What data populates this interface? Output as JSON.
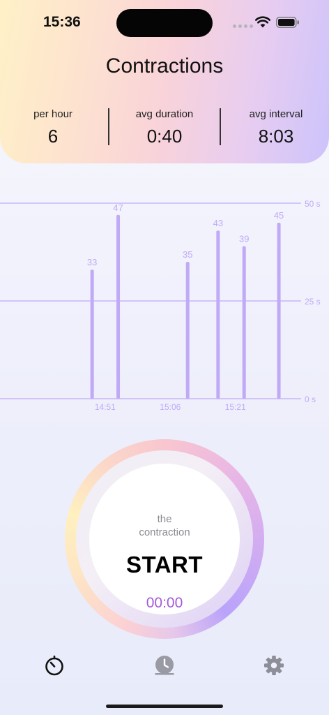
{
  "status_bar": {
    "time": "15:36"
  },
  "header": {
    "title": "Contractions",
    "stats": [
      {
        "label": "per hour",
        "value": "6"
      },
      {
        "label": "avg duration",
        "value": "0:40"
      },
      {
        "label": "avg interval",
        "value": "8:03"
      }
    ]
  },
  "chart_data": {
    "type": "bar",
    "x": [
      "14:48",
      "14:54",
      "15:10",
      "15:17",
      "15:23",
      "15:31"
    ],
    "values": [
      33,
      47,
      35,
      43,
      39,
      45
    ],
    "xticks": [
      "14:51",
      "15:06",
      "15:21"
    ],
    "yticks": [
      "0 s",
      "25 s",
      "50 s"
    ],
    "ylim": [
      0,
      50
    ],
    "bar_color": "#c0aaf8",
    "grid": true
  },
  "button": {
    "subtitle_line1": "the",
    "subtitle_line2": "contraction",
    "label": "START",
    "timer": "00:00"
  },
  "tabs": [
    {
      "name": "timer",
      "icon": "stopwatch-icon"
    },
    {
      "name": "history",
      "icon": "clock-icon"
    },
    {
      "name": "settings",
      "icon": "gear-icon"
    }
  ],
  "colors": {
    "accent": "#a45ad8",
    "chart": "#c0aaf8"
  }
}
